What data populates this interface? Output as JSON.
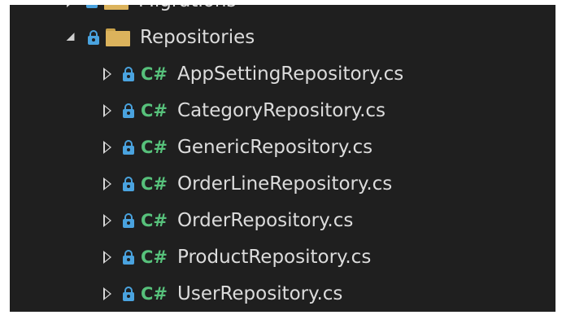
{
  "solution_explorer": {
    "partial_folder": {
      "label": "Migrations",
      "icon": "folder-icon",
      "lock_icon": "lock-icon"
    },
    "folder": {
      "label": "Repositories",
      "expanded": true,
      "icon": "folder-icon",
      "lock_icon": "lock-icon"
    },
    "file_type_badge": "C#",
    "files": [
      {
        "label": "AppSettingRepository.cs"
      },
      {
        "label": "CategoryRepository.cs"
      },
      {
        "label": "GenericRepository.cs"
      },
      {
        "label": "OrderLineRepository.cs"
      },
      {
        "label": "OrderRepository.cs"
      },
      {
        "label": "ProductRepository.cs"
      },
      {
        "label": "UserRepository.cs"
      }
    ]
  },
  "colors": {
    "background": "#1f1f1f",
    "text": "#dcdcdc",
    "lock": "#4aa3df",
    "csharp": "#57c17b",
    "folder": "#dcb35c"
  }
}
